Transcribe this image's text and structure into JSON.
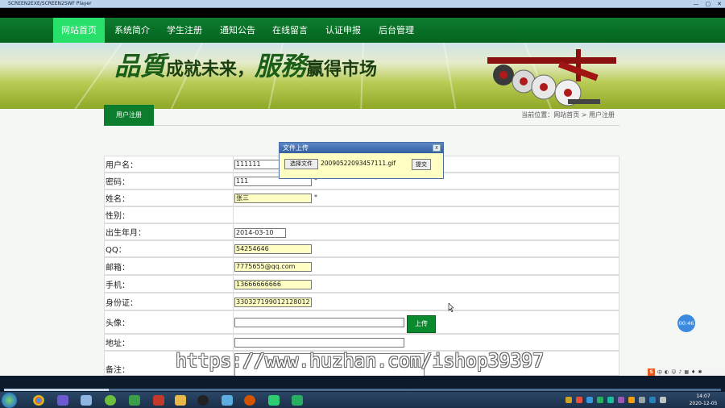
{
  "player": {
    "title": "SCREEN2EXE/SCREEN2SWF Player",
    "window_controls": [
      "—",
      "▢",
      "✕"
    ]
  },
  "nav": {
    "items": [
      {
        "label": "网站首页",
        "active": true
      },
      {
        "label": "系统简介",
        "active": false
      },
      {
        "label": "学生注册",
        "active": false
      },
      {
        "label": "通知公告",
        "active": false
      },
      {
        "label": "在线留言",
        "active": false
      },
      {
        "label": "认证申报",
        "active": false
      },
      {
        "label": "后台管理",
        "active": false
      }
    ]
  },
  "banner": {
    "slogan_part1": "品質",
    "slogan_part2": "成就未来，",
    "slogan_part3": "服務",
    "slogan_part4": "赢得市场"
  },
  "panel": {
    "tab_label": "用户注册",
    "breadcrumb": "当前位置：网站首页 > 用户注册"
  },
  "form": {
    "fields": [
      {
        "label": "用户名：",
        "value": "111111",
        "highlight": false
      },
      {
        "label": "密码：",
        "value": "111",
        "highlight": false
      },
      {
        "label": "姓名：",
        "value": "张三",
        "highlight": true
      },
      {
        "label": "性别：",
        "value": "",
        "highlight": false
      },
      {
        "label": "出生年月：",
        "value": "2014-03-10",
        "highlight": false
      },
      {
        "label": "QQ：",
        "value": "54254646",
        "highlight": true
      },
      {
        "label": "邮箱：",
        "value": "7775655@qq.com",
        "highlight": true
      },
      {
        "label": "手机：",
        "value": "13666666666",
        "highlight": true
      },
      {
        "label": "身份证：",
        "value": "330327199012128012",
        "highlight": true
      },
      {
        "label": "头像：",
        "value": "",
        "highlight": false
      },
      {
        "label": "地址：",
        "value": "",
        "highlight": false
      },
      {
        "label": "备注：",
        "value": "",
        "highlight": false
      }
    ],
    "required_mark": "*",
    "upload_button": "上传"
  },
  "dialog": {
    "title": "文件上传",
    "close": "x",
    "choose_button": "选择文件",
    "file_name": "20090522093457111.gif",
    "submit_button": "提交"
  },
  "overlay": {
    "float_timer": "00:46",
    "watermark": "https://www.huzhan.com/ishop39397"
  },
  "ime": {
    "logo": "S",
    "label": "中"
  },
  "clock": {
    "time": "14:07",
    "date": "2020-12-05"
  },
  "colors": {
    "nav_green": "#0b7d2c",
    "nav_active": "#27e06a",
    "highlight_field": "#ffffc4"
  }
}
